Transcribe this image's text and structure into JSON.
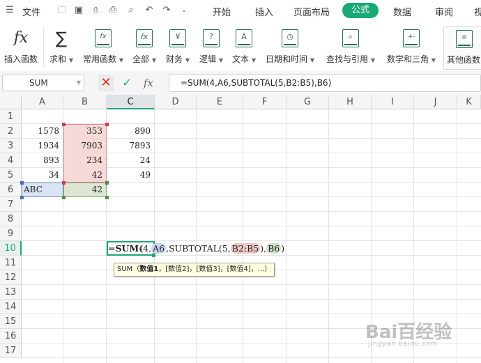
{
  "menu": {
    "file": "文件",
    "tabs": [
      "开始",
      "插入",
      "页面布局",
      "公式",
      "数据",
      "审阅",
      "视"
    ],
    "active_tab": "公式",
    "accent_color": "#19a974"
  },
  "ribbon": {
    "buttons": [
      {
        "label": "插入函数",
        "icon": "fx-icon"
      },
      {
        "label": "求和",
        "icon": "sigma-icon",
        "dropdown": true
      },
      {
        "label": "常用函数",
        "icon": "fx-star-icon",
        "dropdown": true
      },
      {
        "label": "全部",
        "icon": "fx-doc-icon",
        "dropdown": true
      },
      {
        "label": "财务",
        "icon": "yen-doc-icon",
        "dropdown": true
      },
      {
        "label": "逻辑",
        "icon": "question-doc-icon",
        "dropdown": true
      },
      {
        "label": "文本",
        "icon": "a-doc-icon",
        "dropdown": true
      },
      {
        "label": "日期和时间",
        "icon": "clock-doc-icon",
        "dropdown": true
      },
      {
        "label": "查找与引用",
        "icon": "search-doc-icon",
        "dropdown": true
      },
      {
        "label": "数学和三角",
        "icon": "math-doc-icon",
        "dropdown": true
      },
      {
        "label": "其他函数",
        "icon": "more-doc-icon",
        "dropdown": false
      }
    ]
  },
  "formula_bar": {
    "name_box": "SUM",
    "fx_symbol": "fx",
    "formula": "=SUM(4,A6,SUBTOTAL(5,B2:B5),B6)"
  },
  "sheet": {
    "columns": [
      "A",
      "B",
      "C",
      "D",
      "E",
      "F",
      "G",
      "H",
      "I",
      "J",
      "K"
    ],
    "rows": [
      "1",
      "2",
      "3",
      "4",
      "5",
      "6",
      "7",
      "8",
      "9",
      "10",
      "11",
      "12",
      "13",
      "14",
      "15",
      "16",
      "17"
    ],
    "cells": {
      "A2": "1578",
      "B2": "353",
      "C2": "890",
      "A3": "1934",
      "B3": "7903",
      "C3": "7893",
      "A4": "893",
      "B4": "234",
      "C4": "24",
      "A5": "34",
      "B5": "42",
      "C5": "49",
      "A6": "ABC",
      "B6": "42"
    },
    "editing": {
      "prefix": "=",
      "func": "SUM(",
      "arg1": "4,",
      "ref1": "A6",
      "mid": ",SUBTOTAL(5,",
      "ref2": "B2:B5",
      "sep": "),",
      "ref3": "B6",
      "close": ")",
      "colors": {
        "ref1": "#c9d6ef",
        "ref2": "#f0c8c8",
        "ref3": "#cfdfc3"
      }
    },
    "tooltip": {
      "fn": "SUM（",
      "arg_bold": "数值1",
      "rest": "，[数值2]，[数值3]，[数值4]，...）"
    }
  },
  "watermark": {
    "brand": "Bai百经验",
    "url": "jingyan.baidu.com"
  }
}
